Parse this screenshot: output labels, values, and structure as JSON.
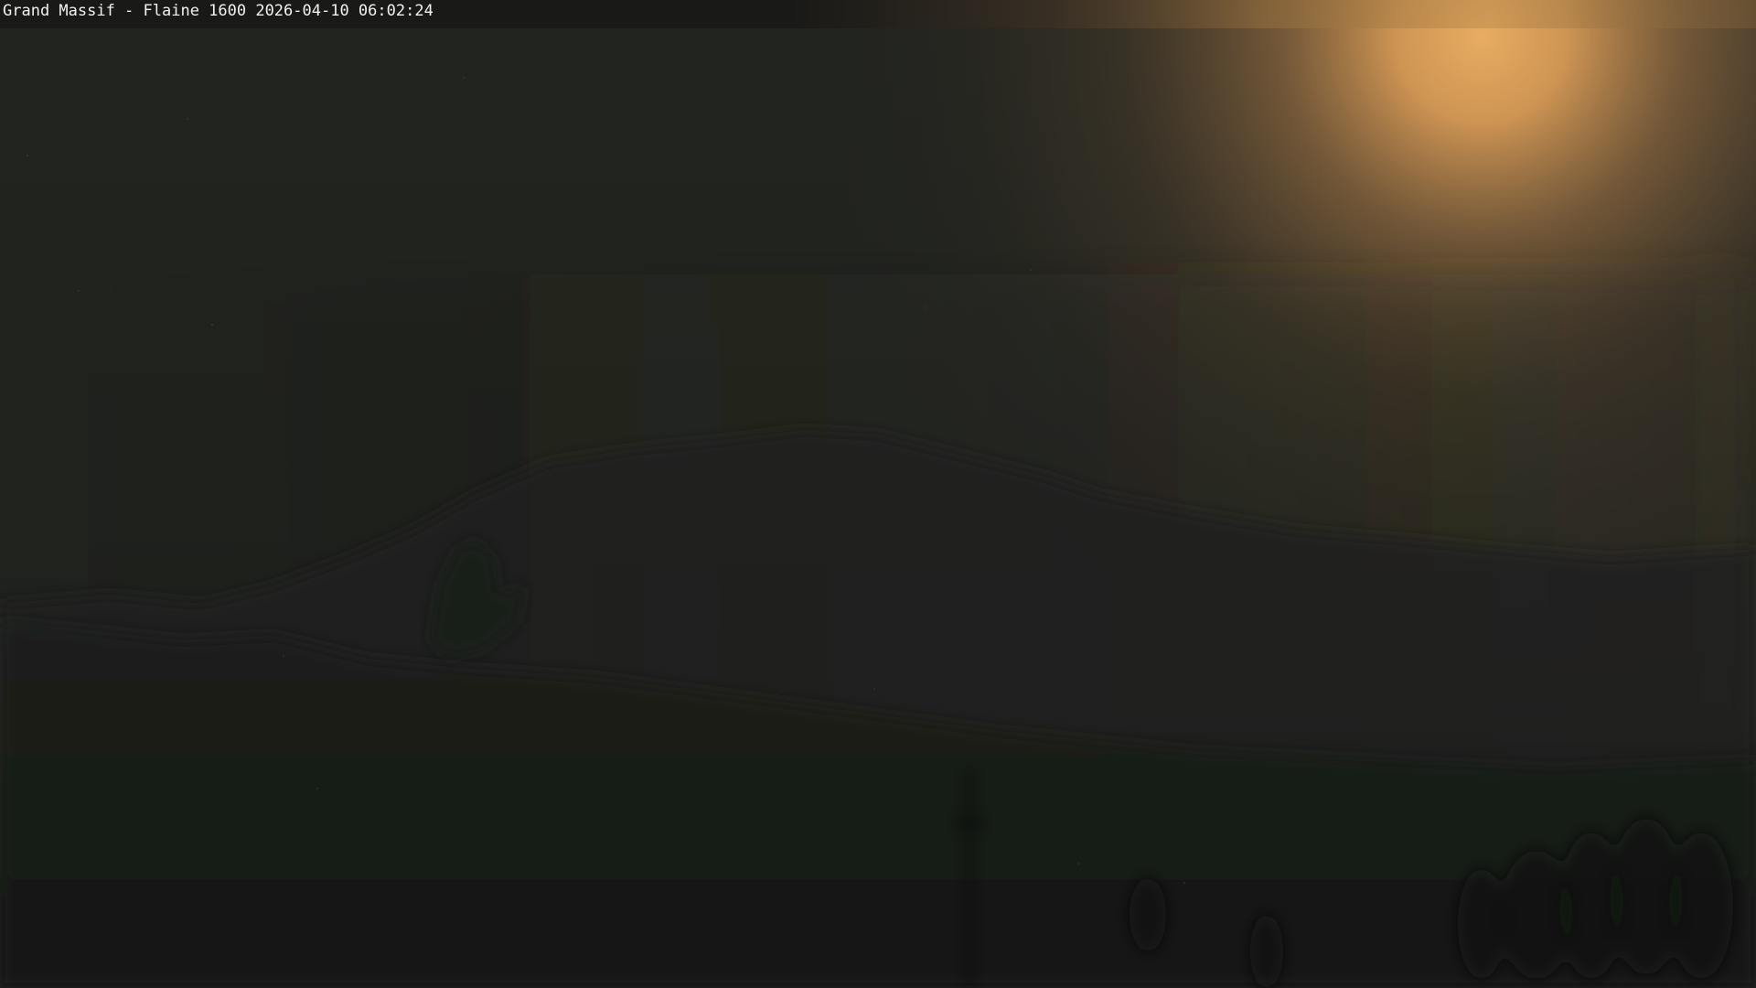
{
  "webcam": {
    "caption": "Grand Massif - Flaine 1600 2026-04-10 06:02:24",
    "colors": {
      "sky_dark": "#1f211d",
      "glow_core": "#e2a65e",
      "glow_mid": "#7a5a38",
      "mountain": "#1b1e1a",
      "foreground": "#161915"
    }
  }
}
